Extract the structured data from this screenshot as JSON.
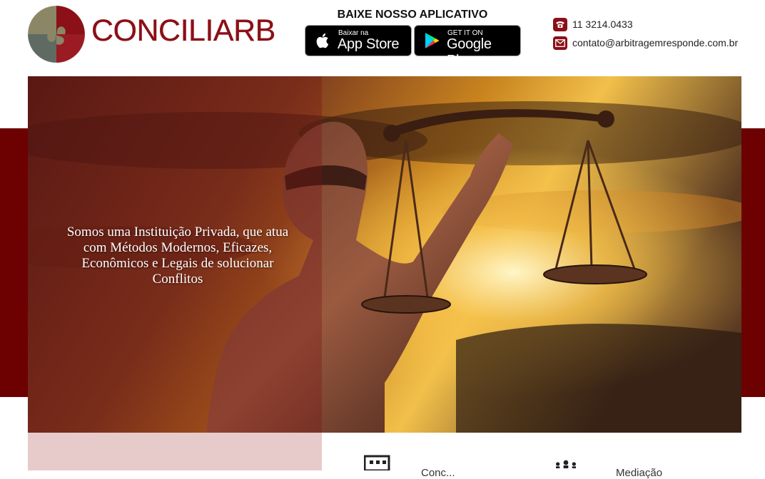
{
  "brand": {
    "name": "CONCILIARB",
    "colors": {
      "primary": "#8b1017",
      "band": "#6d0000",
      "pink": "#e7cbcb",
      "olive": "#8a8666",
      "slate": "#5f6b62"
    }
  },
  "header": {
    "app_title": "BAIXE NOSSO APLICATIVO",
    "app_store": {
      "small": "Baixar na",
      "big": "App Store",
      "icon": "apple-icon"
    },
    "google_play": {
      "small": "GET IT ON",
      "big": "Google Play",
      "icon": "google-play-icon"
    },
    "contact": {
      "phone": "11 3214.0433",
      "phone_icon": "phone-icon",
      "email": "contato@arbitragemresponde.com.br",
      "email_icon": "envelope-icon"
    }
  },
  "hero": {
    "tagline": "Somos uma Instituição Privada, que atua com Métodos Modernos, Eficazes, Econômicos e Legais de solucionar Conflitos",
    "image": "lady-justice-scales-sunset"
  },
  "services": [
    {
      "label": "Conc...",
      "icon": "building-icon"
    },
    {
      "label": "Mediação",
      "icon": "people-icon"
    }
  ]
}
